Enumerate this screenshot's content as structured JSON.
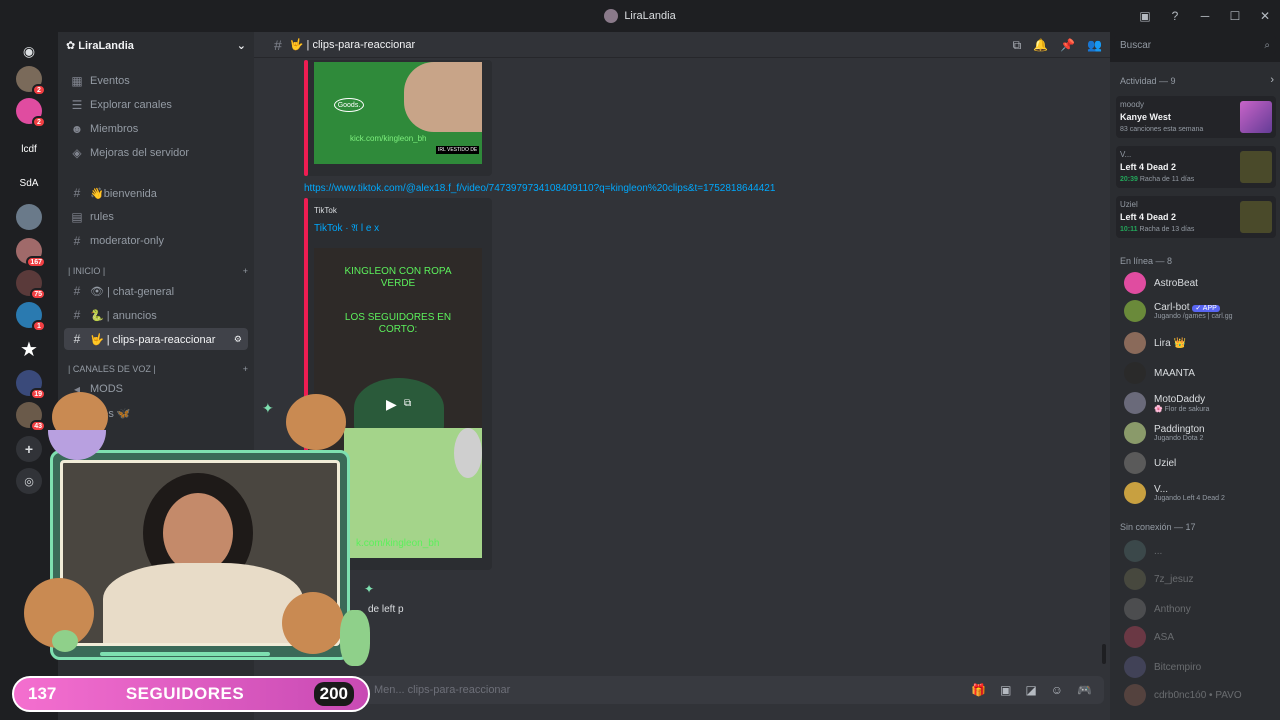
{
  "window": {
    "title": "LiraLandia"
  },
  "servers": {
    "items": [
      {
        "icon": "discord-home-icon"
      },
      {
        "badge": "2"
      },
      {
        "badge": "2"
      },
      {
        "label": "lcdf"
      },
      {
        "label": "SdA"
      },
      {
        "badge": ""
      },
      {
        "badge": "167"
      },
      {
        "badge": "75"
      },
      {
        "badge": "1"
      },
      {
        "icon": "star-icon"
      },
      {
        "badge": "19"
      },
      {
        "badge": "43"
      }
    ]
  },
  "guild": {
    "name": "LiraLandia",
    "top_items": [
      "Eventos",
      "Explorar canales",
      "Miembros",
      "Mejoras del servidor"
    ],
    "channels": [
      "👋bienvenida",
      "rules",
      "moderator-only"
    ],
    "category_inicio": "| INICIO |",
    "inicio_channels": [
      "👁 | chat-general",
      "🐍 | anuncios",
      "🤟 | clips-para-reaccionar"
    ],
    "category_voz": "| CANALES DE VOZ |",
    "voice_channels": [
      "MODS",
      "...tes 🦋"
    ]
  },
  "main": {
    "channel": "🤟 | clips-para-reaccionar",
    "link": "https://www.tiktok.com/@alex18.f_f/video/7473979734108409110?q=kingleon%20clips&t=1752818644421",
    "embed_provider": "TikTok",
    "embed_author": "TikTok · 𝔄 l e x",
    "thumb1_text": "kick.com/kingleon_bh",
    "thumb1_caption": "IRL VESTIDO DE",
    "thumb2_title": "KINGLEON CON ROPA VERDE",
    "thumb2_sub": "LOS SEGUIDORES EN CORTO:",
    "thumb2_footer": "k.com/kingleon_bh",
    "partial_text": "de left p",
    "composer_placeholder": "Men... clips-para-reaccionar",
    "search_placeholder": "Buscar"
  },
  "activity": {
    "title": "Actividad — 9",
    "items": [
      {
        "user": "moody",
        "title": "Kanye West",
        "detail": "83 canciones esta semana",
        "time": ""
      },
      {
        "user": "V...",
        "title": "Left 4 Dead 2",
        "detail": "Racha de 11 días",
        "time": "20:39"
      },
      {
        "user": "Uziel",
        "title": "Left 4 Dead 2",
        "detail": "Racha de 13 días",
        "time": "10:11"
      }
    ]
  },
  "online": {
    "title": "En línea — 8",
    "members": [
      {
        "name": "AstroBeat",
        "status": "",
        "color": "#e04ca0"
      },
      {
        "name": "Carl-bot",
        "status": "Jugando /games | carl.gg",
        "tag": "✓ APP",
        "color": "#6a8a3a"
      },
      {
        "name": "Lira 👑",
        "status": "",
        "color": "#8a6a5a"
      },
      {
        "name": "MAANTA",
        "status": "",
        "color": "#2a2a2a"
      },
      {
        "name": "MotoDaddy",
        "status": "🌸 Flor de sakura",
        "color": "#6a6a7a"
      },
      {
        "name": "Paddington",
        "status": "Jugando Dota 2",
        "color": "#8a9a6a"
      },
      {
        "name": "Uziel",
        "status": "",
        "color": "#5a5a5a"
      },
      {
        "name": "V...",
        "status": "Jugando Left 4 Dead 2",
        "color": "#c8a040"
      }
    ]
  },
  "offline": {
    "title": "Sin conexión — 17",
    "members": [
      "...",
      "7z_jesuz",
      "Anthony",
      "ASA",
      "Bitcempiro",
      "cdrb0nc1ó0 • PAVO"
    ]
  },
  "overlay": {
    "followers_current": "137",
    "followers_label": "SEGUIDORES",
    "followers_goal": "200"
  }
}
